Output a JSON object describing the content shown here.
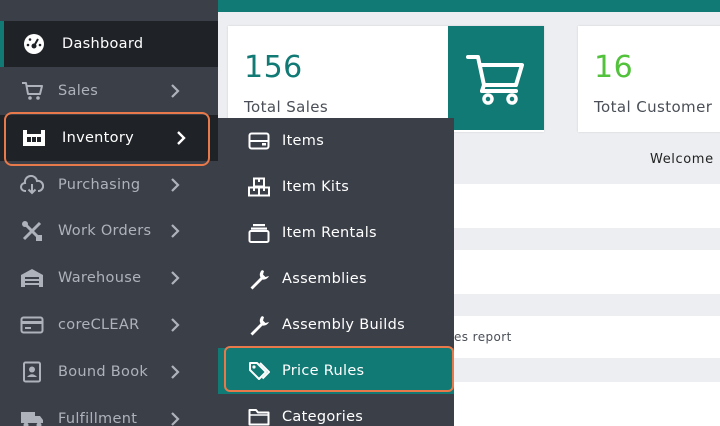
{
  "colors": {
    "accent": "#117a75",
    "highlight": "#e8794a",
    "sidebar": "#3b3f48",
    "active": "#1f2227",
    "green_number": "#52c13b"
  },
  "sidebar": {
    "items": [
      {
        "label": "Dashboard",
        "icon": "dashboard-icon"
      },
      {
        "label": "Sales",
        "icon": "cart-icon"
      },
      {
        "label": "Inventory",
        "icon": "inventory-icon"
      },
      {
        "label": "Purchasing",
        "icon": "cloud-download-icon"
      },
      {
        "label": "Work Orders",
        "icon": "tools-icon"
      },
      {
        "label": "Warehouse",
        "icon": "warehouse-icon"
      },
      {
        "label": "coreCLEAR",
        "icon": "credit-card-icon"
      },
      {
        "label": "Bound Book",
        "icon": "address-book-icon"
      },
      {
        "label": "Fulfillment",
        "icon": "truck-icon"
      }
    ]
  },
  "submenu": {
    "items": [
      {
        "label": "Items",
        "icon": "items-icon"
      },
      {
        "label": "Item Kits",
        "icon": "boxes-icon"
      },
      {
        "label": "Item Rentals",
        "icon": "rentals-icon"
      },
      {
        "label": "Assemblies",
        "icon": "wrench-icon"
      },
      {
        "label": "Assembly Builds",
        "icon": "wrench-icon"
      },
      {
        "label": "Price Rules",
        "icon": "tags-icon"
      },
      {
        "label": "Categories",
        "icon": "folder-icon"
      }
    ]
  },
  "cards": [
    {
      "number": "156",
      "caption": "Total Sales",
      "icon": "cart-icon"
    },
    {
      "number": "16",
      "caption": "Total Customer"
    }
  ],
  "welcome": "Welcome",
  "report_text": "es report"
}
